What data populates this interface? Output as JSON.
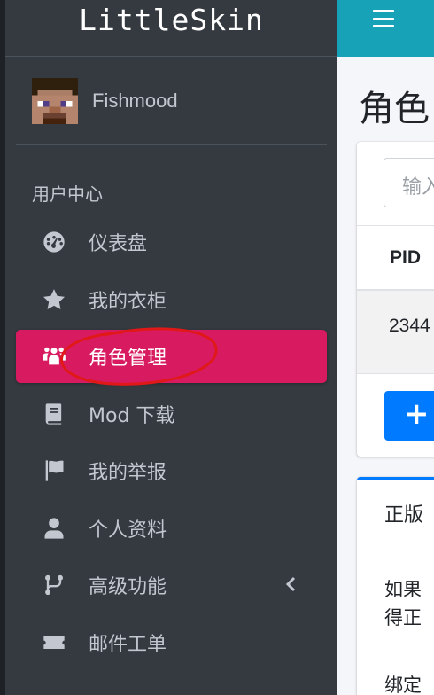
{
  "brand": {
    "name": "LittleSkin"
  },
  "user": {
    "name": "Fishmood"
  },
  "sidebar": {
    "header": "用户中心",
    "items": [
      {
        "label": "仪表盘",
        "icon": "dashboard-icon"
      },
      {
        "label": "我的衣柜",
        "icon": "star-icon"
      },
      {
        "label": "角色管理",
        "icon": "users-icon",
        "active": true
      },
      {
        "label": "Mod 下载",
        "icon": "book-icon"
      },
      {
        "label": "我的举报",
        "icon": "flag-icon"
      },
      {
        "label": "个人资料",
        "icon": "user-icon"
      },
      {
        "label": "高级功能",
        "icon": "code-branch-icon",
        "expandable": true
      },
      {
        "label": "邮件工单",
        "icon": "ticket-icon"
      }
    ],
    "active_color": "#d81b60"
  },
  "topbar": {
    "color": "#17a2b8",
    "menu_icon": "hamburger-icon"
  },
  "main": {
    "title": "角色",
    "search": {
      "placeholder": "输入"
    },
    "table": {
      "headers": [
        "PID"
      ],
      "rows": [
        [
          "2344"
        ]
      ]
    },
    "add_button": {
      "label": "+"
    },
    "card2": {
      "title": "正版",
      "line1": "如果",
      "line2": "得正",
      "line3": "绑定"
    }
  }
}
